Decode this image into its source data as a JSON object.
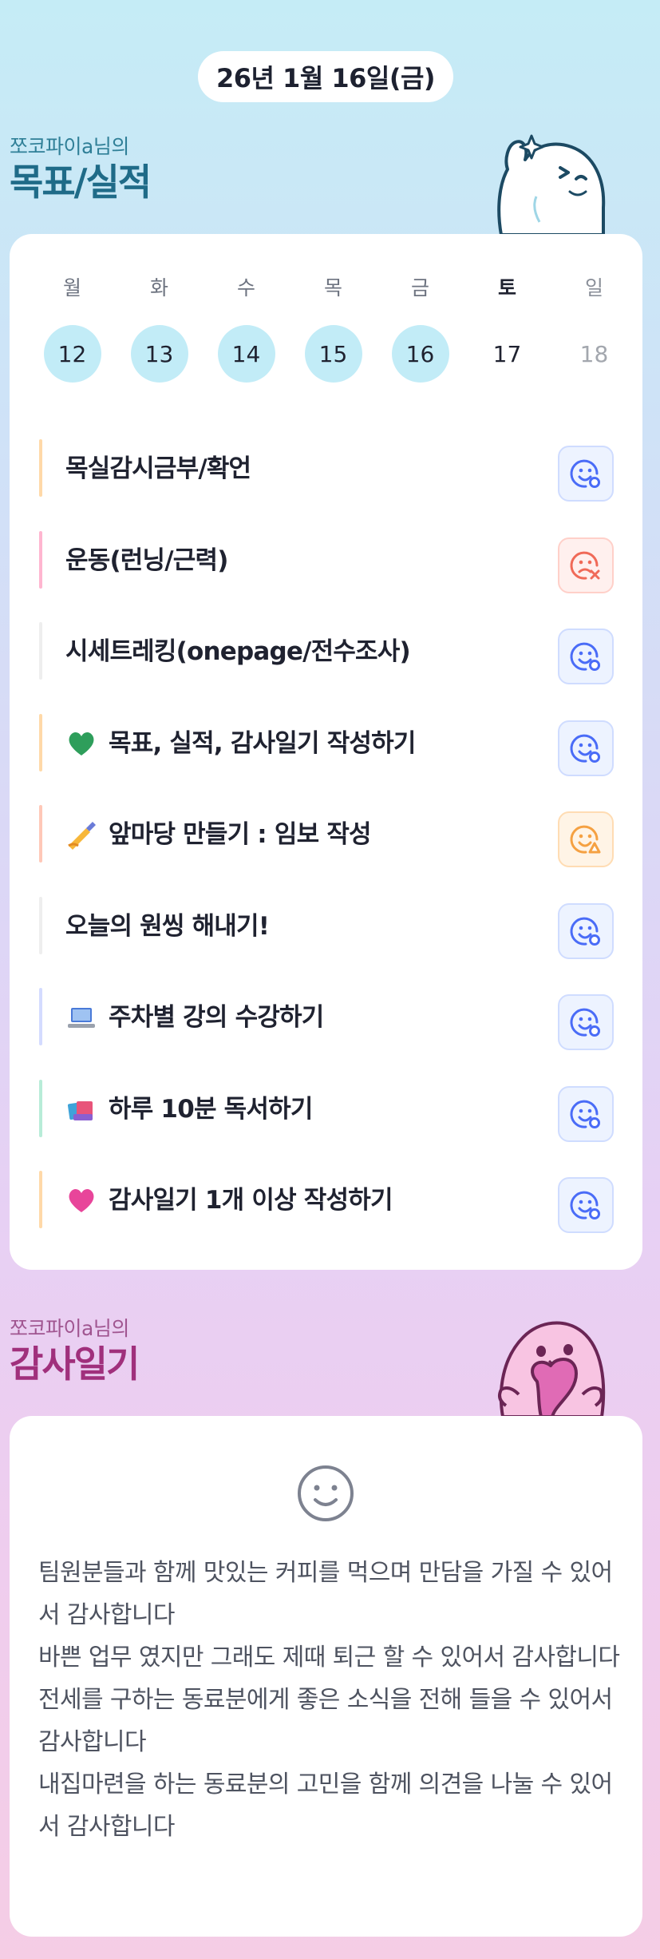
{
  "header": {
    "date": "26년 1월 16일(금)"
  },
  "goals_section": {
    "owner": "쪼코파이a님의",
    "title": "목표/실적"
  },
  "week": [
    {
      "day": "월",
      "date": "12",
      "state": "done"
    },
    {
      "day": "화",
      "date": "13",
      "state": "done"
    },
    {
      "day": "수",
      "date": "14",
      "state": "done"
    },
    {
      "day": "목",
      "date": "15",
      "state": "done"
    },
    {
      "day": "금",
      "date": "16",
      "state": "done"
    },
    {
      "day": "토",
      "date": "17",
      "state": "today"
    },
    {
      "day": "일",
      "date": "18",
      "state": "future"
    }
  ],
  "goals": [
    {
      "emoji": "",
      "label": "목실감시금부/확언",
      "bar": "#ffd9a8",
      "status": "ok"
    },
    {
      "emoji": "",
      "label": "운동(런닝/근력)",
      "bar": "#ffb6d0",
      "status": "fail"
    },
    {
      "emoji": "",
      "label": "시세트레킹(onepage/전수조사)",
      "bar": "#eeeeee",
      "status": "ok"
    },
    {
      "emoji": "green-heart-icon",
      "label": "목표, 실적, 감사일기 작성하기",
      "bar": "#ffd9a8",
      "status": "ok"
    },
    {
      "emoji": "writing-hand-icon",
      "label": "앞마당 만들기 : 임보 작성",
      "bar": "#ffc8b8",
      "status": "warn"
    },
    {
      "emoji": "",
      "label": "오늘의 원씽 해내기!",
      "bar": "#eeeeee",
      "status": "ok"
    },
    {
      "emoji": "laptop-icon",
      "label": "주차별 강의 수강하기",
      "bar": "#d4dbff",
      "status": "ok"
    },
    {
      "emoji": "books-icon",
      "label": "하루 10분 독서하기",
      "bar": "#b8ecd8",
      "status": "ok"
    },
    {
      "emoji": "pink-heart-icon",
      "label": "감사일기 1개 이상 작성하기",
      "bar": "#ffd9a8",
      "status": "ok"
    }
  ],
  "diary_section": {
    "owner": "쪼코파이a님의",
    "title": "감사일기"
  },
  "diary": {
    "mood_icon": "smile-face-icon",
    "lines": [
      "팀원분들과 함께 맛있는 커피를 먹으며 만담을 가질 수 있어서 감사합니다",
      "바쁜 업무 였지만 그래도 제때 퇴근 할 수 있어서 감사합니다",
      "전세를 구하는 동료분에게 좋은 소식을 전해 들을 수 있어서 감사합니다",
      "내집마련을 하는 동료분의 고민을 함께 의견을 나눌 수 있어서 감사합니다"
    ]
  },
  "colors": {
    "status_ok": "#4a6cf7",
    "status_fail": "#f06a58",
    "status_warn": "#f5a142",
    "done_circle": "#c2ecf7"
  }
}
